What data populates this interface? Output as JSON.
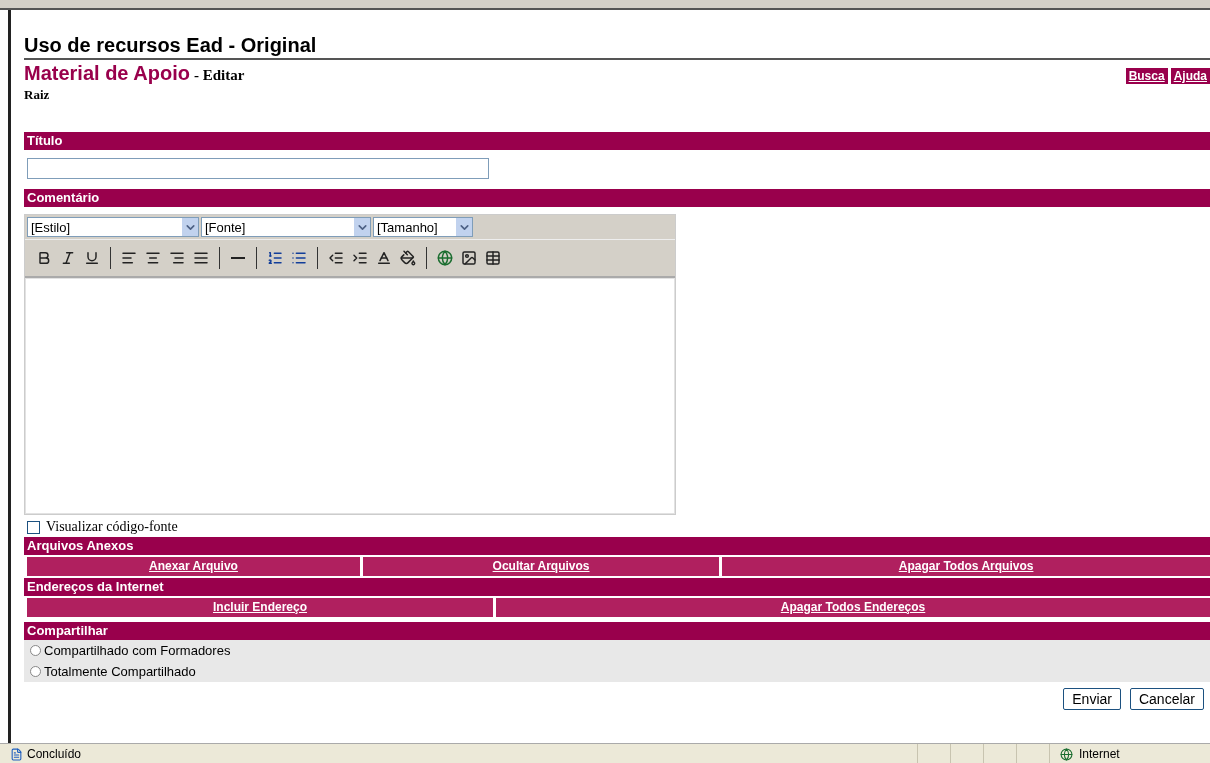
{
  "page": {
    "title": "Uso de recursos Ead - Original",
    "heading": "Material de Apoio",
    "action": "- Editar",
    "breadcrumb": "Raiz",
    "links": [
      "Busca",
      "Ajuda"
    ]
  },
  "title_section": {
    "label": "Título"
  },
  "comment_section": {
    "label": "Comentário",
    "selects": [
      "[Estilo]",
      "[Fonte]",
      "[Tamanho]"
    ],
    "source_checkbox": {
      "label": "Visualizar código-fonte",
      "checked": false
    }
  },
  "attachments": {
    "label": "Arquivos Anexos",
    "actions": [
      "Anexar Arquivo",
      "Ocultar Arquivos",
      "Apagar Todos Arquivos"
    ]
  },
  "addresses": {
    "label": "Endereços da Internet",
    "actions": [
      "Incluir Endereço",
      "Apagar Todos Endereços"
    ]
  },
  "share": {
    "label": "Compartilhar",
    "options": [
      {
        "label": "Compartilhado com Formadores",
        "selected": false
      },
      {
        "label": "Totalmente Compartilhado",
        "selected": false
      }
    ]
  },
  "buttons": [
    "Enviar",
    "Cancelar"
  ],
  "status_bar": {
    "text": "Concluído",
    "zone": "Internet"
  }
}
